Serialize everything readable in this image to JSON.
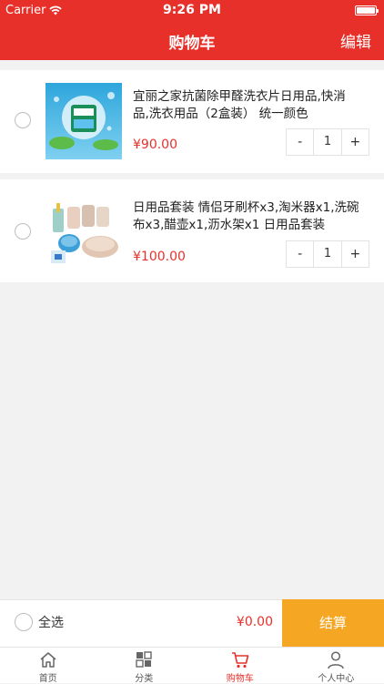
{
  "status_bar": {
    "carrier": "Carrier",
    "time": "9:26 PM"
  },
  "nav": {
    "title": "购物车",
    "edit_label": "编辑"
  },
  "cart_items": [
    {
      "title": "宜丽之家抗菌除甲醛洗衣片日用品,快消品,洗衣用品（2盒装） 统一颜色",
      "price": "¥90.00",
      "quantity": "1",
      "minus_label": "-",
      "plus_label": "+"
    },
    {
      "title": "日用品套装 情侣牙刷杯x3,淘米器x1,洗碗布x3,醋壶x1,沥水架x1 日用品套装",
      "price": "¥100.00",
      "quantity": "1",
      "minus_label": "-",
      "plus_label": "+"
    }
  ],
  "checkout": {
    "select_all_label": "全选",
    "total": "¥0.00",
    "button_label": "结算"
  },
  "tabs": [
    {
      "label": "首页",
      "icon": "home-icon"
    },
    {
      "label": "分类",
      "icon": "category-grid-icon"
    },
    {
      "label": "购物车",
      "icon": "cart-icon",
      "active": true
    },
    {
      "label": "个人中心",
      "icon": "person-icon"
    }
  ],
  "colors": {
    "brand_red": "#e8302a",
    "checkout_orange": "#f5a623",
    "background": "#f2f2f2"
  }
}
